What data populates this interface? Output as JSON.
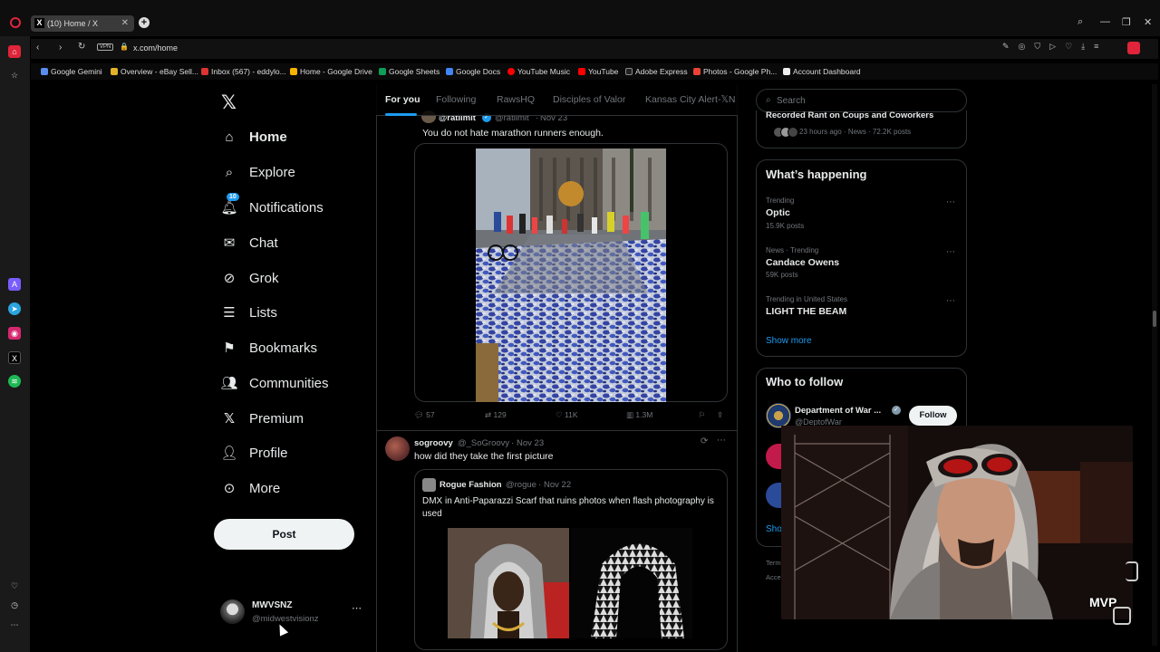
{
  "browser": {
    "tab_title": "(10) Home / X",
    "url": "x.com/home",
    "vpn_label": "VPN",
    "bookmarks": [
      "Google Gemini",
      "Overview - eBay Sell...",
      "Inbox (567) - eddylo...",
      "Home - Google Drive",
      "Google Sheets",
      "Google Docs",
      "YouTube Music",
      "YouTube",
      "Adobe Express",
      "Photos - Google Ph...",
      "Account Dashboard"
    ]
  },
  "nav": {
    "items": [
      "Home",
      "Explore",
      "Notifications",
      "Chat",
      "Grok",
      "Lists",
      "Bookmarks",
      "Communities",
      "Premium",
      "Profile",
      "More"
    ],
    "notification_badge": "10",
    "post_button": "Post",
    "user_name": "MWVSNZ",
    "user_handle": "@midwestvisionz"
  },
  "feed": {
    "tabs": [
      "For you",
      "Following",
      "RawsHQ",
      "Disciples of Valor",
      "Kansas City Alert-𝕏N"
    ],
    "tweet1": {
      "handle": "@ratlimit",
      "name": "@ratlimit",
      "date": "Nov 23",
      "text": "You do not hate marathon runners enough.",
      "replies": "57",
      "retweets": "129",
      "likes": "11K",
      "views": "1.3M"
    },
    "tweet2": {
      "name": "sogroovy",
      "handle": "@_SoGroovy",
      "date": "Nov 23",
      "text": "how did they take the first picture",
      "quote_name": "Rogue Fashion",
      "quote_handle": "@rogue",
      "quote_date": "Nov 22",
      "quote_text": "DMX in Anti-Paparazzi Scarf that ruins photos when flash photography is used"
    }
  },
  "right": {
    "search_placeholder": "Search",
    "top_partial_title": "Recorded Rant on Coups and Coworkers",
    "top_partial_meta": "23 hours ago · News · 72.2K posts",
    "happening_title": "What’s happening",
    "trends": [
      {
        "context": "Trending",
        "name": "Optic",
        "posts": "15.9K posts"
      },
      {
        "context": "News · Trending",
        "name": "Candace Owens",
        "posts": "59K posts"
      },
      {
        "context": "Trending in United States",
        "name": "LIGHT THE BEAM",
        "posts": ""
      }
    ],
    "show_more": "Show more",
    "who_to_follow_title": "Who to follow",
    "follow_name": "Department of War ...",
    "follow_handle": "@DeptofWar",
    "follow_button": "Follow",
    "show_partial": "Sho",
    "terms_partial": "Term",
    "acc_partial": "Acce"
  },
  "overlay": {
    "watermark": "MVP"
  },
  "colors": {
    "accent": "#1d9bf0",
    "bg": "#000000",
    "border": "#2f3336",
    "muted": "#71767b"
  }
}
